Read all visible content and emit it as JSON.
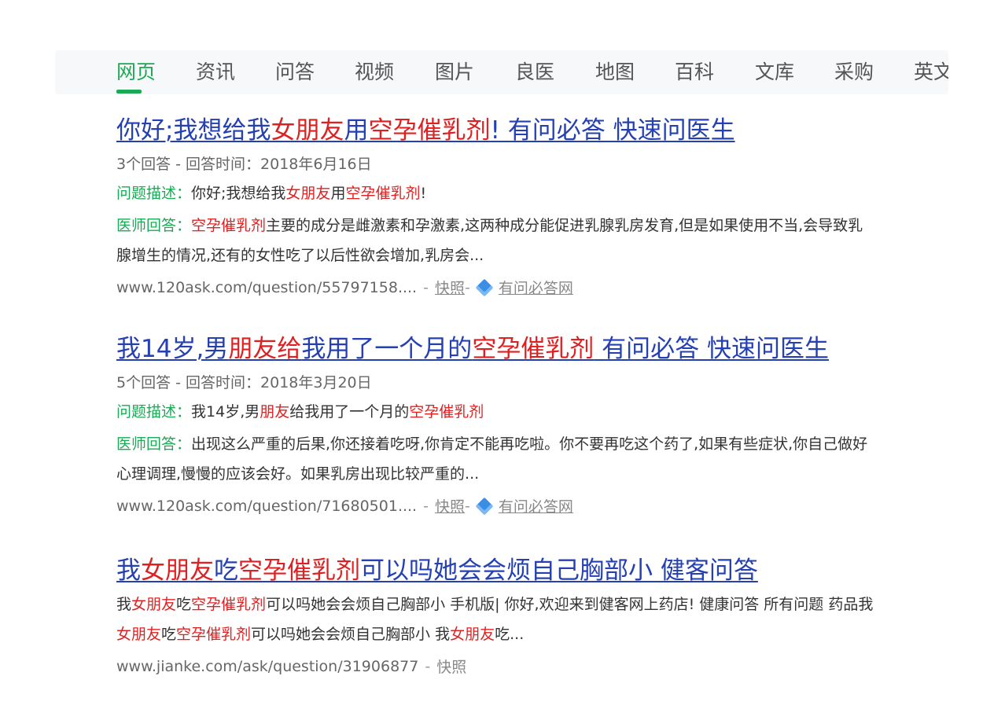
{
  "tabs": [
    "网页",
    "资讯",
    "问答",
    "视频",
    "图片",
    "良医",
    "地图",
    "百科",
    "文库",
    "采购",
    "英文"
  ],
  "active_tab": "网页",
  "results": [
    {
      "title": [
        {
          "t": "你好;我想给我",
          "hl": false
        },
        {
          "t": "女朋友",
          "hl": true
        },
        {
          "t": "用",
          "hl": false
        },
        {
          "t": "空孕催乳剂",
          "hl": true
        },
        {
          "t": "! 有问必答 快速问医生",
          "hl": false
        }
      ],
      "meta": "3个回答 - 回答时间：2018年6月16日",
      "question_label": "问题描述：",
      "question": [
        {
          "t": "你好;我想给我",
          "hl": false
        },
        {
          "t": "女朋友",
          "hl": true
        },
        {
          "t": "用",
          "hl": false
        },
        {
          "t": "空孕催乳剂",
          "hl": true
        },
        {
          "t": "!",
          "hl": false
        }
      ],
      "answer_label": "医师回答：",
      "answer": [
        {
          "t": "空孕催乳剂",
          "hl": true
        },
        {
          "t": "主要的成分是雌激素和孕激素,这两种成分能促进乳腺乳房发育,但是如果使用不当,会导致乳腺增生的情况,还有的女性吃了以后性欲会增加,乳房会...",
          "hl": false
        }
      ],
      "url": "www.120ask.com/question/55797158....",
      "snapshot": "快照",
      "site": "有问必答网"
    },
    {
      "title": [
        {
          "t": "我14岁,男",
          "hl": false
        },
        {
          "t": "朋友给",
          "hl": true
        },
        {
          "t": "我用了一个月的",
          "hl": false
        },
        {
          "t": "空孕催乳剂",
          "hl": true
        },
        {
          "t": " 有问必答 快速问医生",
          "hl": false
        }
      ],
      "meta": "5个回答 - 回答时间：2018年3月20日",
      "question_label": "问题描述：",
      "question": [
        {
          "t": "我14岁,男",
          "hl": false
        },
        {
          "t": "朋友",
          "hl": true
        },
        {
          "t": "给我用了一个月的",
          "hl": false
        },
        {
          "t": "空孕催乳剂",
          "hl": true
        }
      ],
      "answer_label": "医师回答：",
      "answer": [
        {
          "t": "出现这么严重的后果,你还接着吃呀,你肯定不能再吃啦。你不要再吃这个药了,如果有些症状,你自己做好心理调理,慢慢的应该会好。如果乳房出现比较严重的...",
          "hl": false
        }
      ],
      "url": "www.120ask.com/question/71680501....",
      "snapshot": "快照",
      "site": "有问必答网"
    },
    {
      "title": [
        {
          "t": "我",
          "hl": false
        },
        {
          "t": "女朋友",
          "hl": true
        },
        {
          "t": "吃",
          "hl": false
        },
        {
          "t": "空孕催乳剂",
          "hl": true
        },
        {
          "t": "可以吗她会会烦自己胸部小 健客问答",
          "hl": false
        }
      ],
      "snippet": [
        {
          "t": "我",
          "hl": false
        },
        {
          "t": "女朋友",
          "hl": true
        },
        {
          "t": "吃",
          "hl": false
        },
        {
          "t": "空孕催乳剂",
          "hl": true
        },
        {
          "t": "可以吗她会会烦自己胸部小 手机版| 你好,欢迎来到健客网上药店! 健康问答 所有问题 药品我",
          "hl": false
        },
        {
          "t": "女朋友",
          "hl": true
        },
        {
          "t": "吃",
          "hl": false
        },
        {
          "t": "空孕催乳剂",
          "hl": true
        },
        {
          "t": "可以吗她会会烦自己胸部小 我",
          "hl": false
        },
        {
          "t": "女朋友",
          "hl": true
        },
        {
          "t": "吃...",
          "hl": false
        }
      ],
      "url": "www.jianke.com/ask/question/31906877",
      "snapshot": "快照"
    }
  ]
}
